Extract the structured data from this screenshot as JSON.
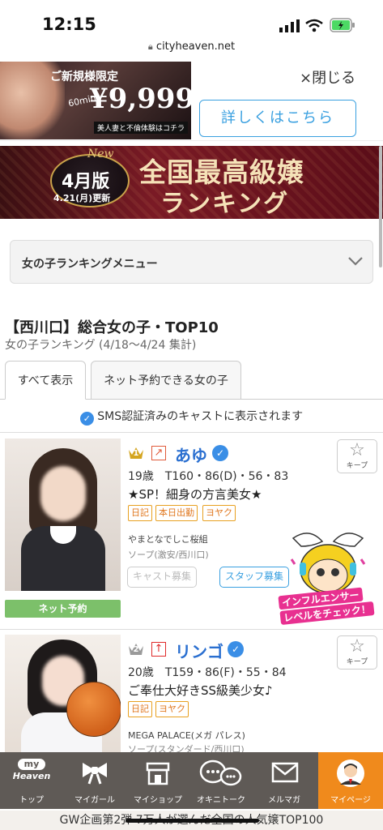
{
  "status": {
    "time": "12:15",
    "url": "cityheaven.net"
  },
  "ad": {
    "promo_line1": "ご新規様限定",
    "promo_time": "60min",
    "promo_price": "¥9,999",
    "promo_sub": "美人妻と不倫体験はコチラ",
    "close_label": "×閉じる",
    "detail_button": "詳しくはこちら"
  },
  "banner": {
    "edition": "4月版",
    "update_date": "4.21(月)更新",
    "title_line1": "全国最高級嬢",
    "title_line2": "ランキング",
    "new_label": "New"
  },
  "menu": {
    "label": "女の子ランキングメニュー"
  },
  "ranking": {
    "title": "【西川口】総合女の子・TOP10",
    "subtitle": "女の子ランキング (4/18～4/24 集計)",
    "tabs": [
      {
        "label": "すべて表示",
        "active": true
      },
      {
        "label": "ネット予約できる女の子",
        "active": false
      }
    ],
    "sms_note": "SMS認証済みのキャストに表示されます",
    "casts": [
      {
        "rank": "1",
        "trend": "up",
        "name": "あゆ",
        "stats": "19歳　T160・86(D)・56・83",
        "catch": "★SP！細身の方言美女★",
        "tags": [
          "日記",
          "本日出勤",
          "ヨヤク"
        ],
        "shop": "やまとなでしこ桜組",
        "genre": "ソープ(激安/西川口)",
        "recruit_cast": "キャスト募集",
        "recruit_staff": "スタッフ募集",
        "net_reserve": "ネット予約",
        "keep": "キープ"
      },
      {
        "rank": "2",
        "trend": "up",
        "name": "リンゴ",
        "stats": "20歳　T159・86(F)・55・84",
        "catch": "ご奉仕大好きSS級美少女♪",
        "tags": [
          "日記",
          "ヨヤク"
        ],
        "shop": "MEGA PALACE(メガ パレス)",
        "genre": "ソープ(スタンダード/西川口)",
        "keep": "キープ"
      }
    ]
  },
  "mascot": {
    "text_line1": "インフルエンサー",
    "text_line2": "レベルをチェック！"
  },
  "bottom_nav": [
    {
      "label": "トップ",
      "icon": "my-heaven-icon",
      "brand_top": "my",
      "brand_bottom": "Heaven"
    },
    {
      "label": "マイガール",
      "icon": "ribbon-icon"
    },
    {
      "label": "マイショップ",
      "icon": "shop-icon"
    },
    {
      "label": "オキニトーク",
      "icon": "chat-icon"
    },
    {
      "label": "メルマガ",
      "icon": "mail-icon"
    },
    {
      "label": "マイページ",
      "icon": "user-avatar-icon"
    }
  ],
  "footer": {
    "text": "GW企画第2弾 7万人が選んだ全国の人気嬢TOP100"
  },
  "colors": {
    "accent": "#3aa0e0",
    "name_blue": "#2a6fd0",
    "nav_bg": "#5f5a56",
    "nav_active": "#f08a1c",
    "net_green": "#7cc06a",
    "tag_orange": "#e07820"
  }
}
